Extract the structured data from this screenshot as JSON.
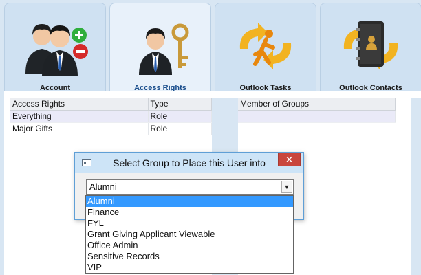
{
  "tabs": [
    {
      "label": "Account",
      "icon": "users-add-remove-icon",
      "active": false
    },
    {
      "label": "Access Rights",
      "icon": "user-key-icon",
      "active": true
    },
    {
      "label": "Outlook Tasks",
      "icon": "tasks-sync-icon",
      "active": false
    },
    {
      "label": "Outlook Contacts",
      "icon": "contacts-sync-icon",
      "active": false
    }
  ],
  "access_grid": {
    "columns": [
      "Access Rights",
      "Type"
    ],
    "rows": [
      [
        "Everything",
        "Role"
      ],
      [
        "Major Gifts",
        "Role"
      ]
    ]
  },
  "groups_grid": {
    "columns": [
      "Member of Groups"
    ]
  },
  "dialog": {
    "title": "Select Group to Place this User into",
    "close": "✕",
    "selected": "Alumni",
    "options": [
      "Alumni",
      "Finance",
      "FYL",
      "Grant Giving Applicant Viewable",
      "Office Admin",
      "Sensitive Records",
      "VIP"
    ]
  },
  "colors": {
    "accent": "#3399ff",
    "close": "#c9463d",
    "titlebar": "#cde4f7"
  }
}
